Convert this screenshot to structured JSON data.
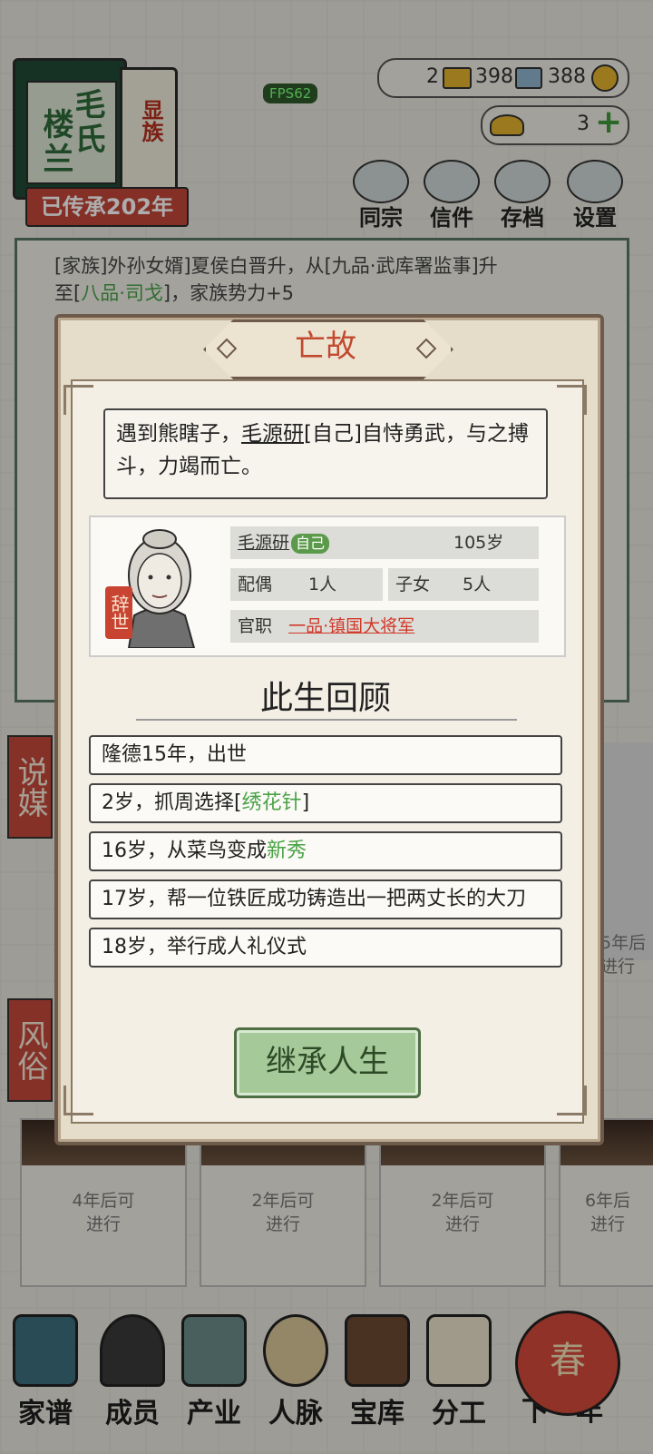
{
  "hud": {
    "clan_name": "楼兰",
    "family_name": "毛氏",
    "clan_rank": "显族",
    "inherited": "已传承202年",
    "fps": "FPS62",
    "resources": {
      "gold_bar": "2",
      "silver_ingot": "398",
      "copper_coin": "388",
      "yuanbao": "3"
    }
  },
  "top_buttons": [
    {
      "label": "同宗",
      "icon": "books-icon"
    },
    {
      "label": "信件",
      "icon": "letter-icon"
    },
    {
      "label": "存档",
      "icon": "save-scroll-icon"
    },
    {
      "label": "设置",
      "icon": "gear-icon"
    }
  ],
  "background_log": {
    "line1": "[家族]外孙女婿]夏侯白晋升，从[九品·武库署监事]升",
    "line2_prefix": "至[",
    "line2_rank": "八品·司戈",
    "line2_suffix": "]，家族势力+5"
  },
  "side_tags": [
    "说媒",
    "风俗"
  ],
  "bg_cards": [
    {
      "text": "4年后可\n进行"
    },
    {
      "text": "2年后可\n进行"
    },
    {
      "text": "2年后可\n进行"
    },
    {
      "text": "6年后\n进行"
    }
  ],
  "bg_card_right": "5年后\n进行",
  "nav": [
    {
      "label": "家谱",
      "icon": "genealogy-book-icon"
    },
    {
      "label": "成员",
      "icon": "member-icon"
    },
    {
      "label": "产业",
      "icon": "building-icon"
    },
    {
      "label": "人脉",
      "icon": "network-icon"
    },
    {
      "label": "宝库",
      "icon": "treasure-chest-icon"
    },
    {
      "label": "分工",
      "icon": "scroll-icon"
    },
    {
      "label": "下一年",
      "icon": "lantern-icon"
    }
  ],
  "next_year_lantern": "春",
  "dialog": {
    "title": "亡故",
    "event": {
      "part1": "遇到熊瞎子，",
      "name": "毛源研",
      "part2": "[自己]自恃勇武，与之搏斗，力竭而亡。"
    },
    "person": {
      "name": "毛源研",
      "self_tag": "自己",
      "age": "105岁",
      "spouse_label": "配偶",
      "spouse_value": "1人",
      "children_label": "子女",
      "children_value": "5人",
      "office_label": "官职",
      "office_value": "一品·镇国大将军",
      "status": "辞世"
    },
    "review_title": "此生回顾",
    "review": [
      {
        "text": "隆德15年，出世",
        "highlight": ""
      },
      {
        "text": "2岁，抓周选择[",
        "highlight": "绣花针",
        "suffix": "]"
      },
      {
        "text": "16岁，从菜鸟变成",
        "highlight": "新秀",
        "suffix": ""
      },
      {
        "text": "17岁，帮一位铁匠成功铸造出一把两丈长的大刀",
        "highlight": ""
      },
      {
        "text": "18岁，举行成人礼仪式",
        "highlight": ""
      }
    ],
    "button": "继承人生"
  }
}
